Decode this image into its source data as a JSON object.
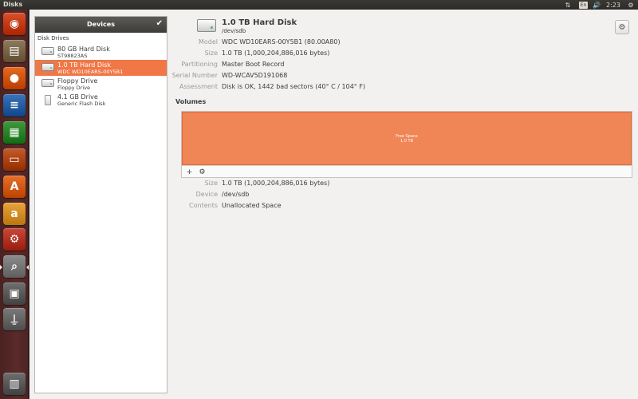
{
  "topbar": {
    "app_title": "Disks",
    "keyboard_layout": "En",
    "time": "2:23"
  },
  "launcher": {
    "items": [
      {
        "name": "dash-home",
        "color": "#d9512a",
        "glyph": "◉"
      },
      {
        "name": "files",
        "color": "#8e7a5c",
        "glyph": "▤"
      },
      {
        "name": "firefox",
        "color": "#e66a1f",
        "glyph": "●"
      },
      {
        "name": "writer",
        "color": "#3b74b8",
        "glyph": "≡"
      },
      {
        "name": "calc",
        "color": "#3f9a3f",
        "glyph": "▦"
      },
      {
        "name": "impress",
        "color": "#c25a2a",
        "glyph": "▭"
      },
      {
        "name": "software-center",
        "color": "#e8702a",
        "glyph": "A"
      },
      {
        "name": "amazon",
        "color": "#e8a43a",
        "glyph": "a"
      },
      {
        "name": "system-settings",
        "color": "#c8483a",
        "glyph": "⚙"
      },
      {
        "name": "disks",
        "color": "#8c8c8c",
        "glyph": "⌕"
      },
      {
        "name": "floppy",
        "color": "#6f6f6f",
        "glyph": "▣"
      },
      {
        "name": "usb-drive",
        "color": "#7a7a7a",
        "glyph": "⍊"
      },
      {
        "name": "trash",
        "color": "#6e6e6e",
        "glyph": "▥"
      }
    ]
  },
  "sidebar": {
    "header": "Devices",
    "section_label": "Disk Drives",
    "drives": [
      {
        "name": "80 GB Hard Disk",
        "sub": "ST98823AS",
        "icon": "hdd-icon"
      },
      {
        "name": "1.0 TB Hard Disk",
        "sub": "WDC WD10EARS-00Y5B1",
        "icon": "hdd-icon",
        "selected": true
      },
      {
        "name": "Floppy Drive",
        "sub": "Floppy Drive",
        "icon": "floppy-icon"
      },
      {
        "name": "4.1 GB Drive",
        "sub": "Generic Flash Disk",
        "icon": "usb-flash-icon"
      }
    ]
  },
  "disk": {
    "title": "1.0 TB Hard Disk",
    "path": "/dev/sdb",
    "props": [
      {
        "key": "Model",
        "value": "WDC WD10EARS-00Y5B1 (80.00A80)"
      },
      {
        "key": "Size",
        "value": "1.0 TB (1,000,204,886,016 bytes)"
      },
      {
        "key": "Partitioning",
        "value": "Master Boot Record"
      },
      {
        "key": "Serial Number",
        "value": "WD-WCAV5D191068"
      },
      {
        "key": "Assessment",
        "value": "Disk is OK, 1442 bad sectors (40° C / 104° F)"
      }
    ]
  },
  "volumes": {
    "heading": "Volumes",
    "segment_label": "Free Space",
    "segment_size": "1.0 TB",
    "segment_color": "#f08556",
    "props": [
      {
        "key": "Size",
        "value": "1.0 TB (1,000,204,886,016 bytes)"
      },
      {
        "key": "Device",
        "value": "/dev/sdb"
      },
      {
        "key": "Contents",
        "value": "Unallocated Space"
      }
    ]
  }
}
